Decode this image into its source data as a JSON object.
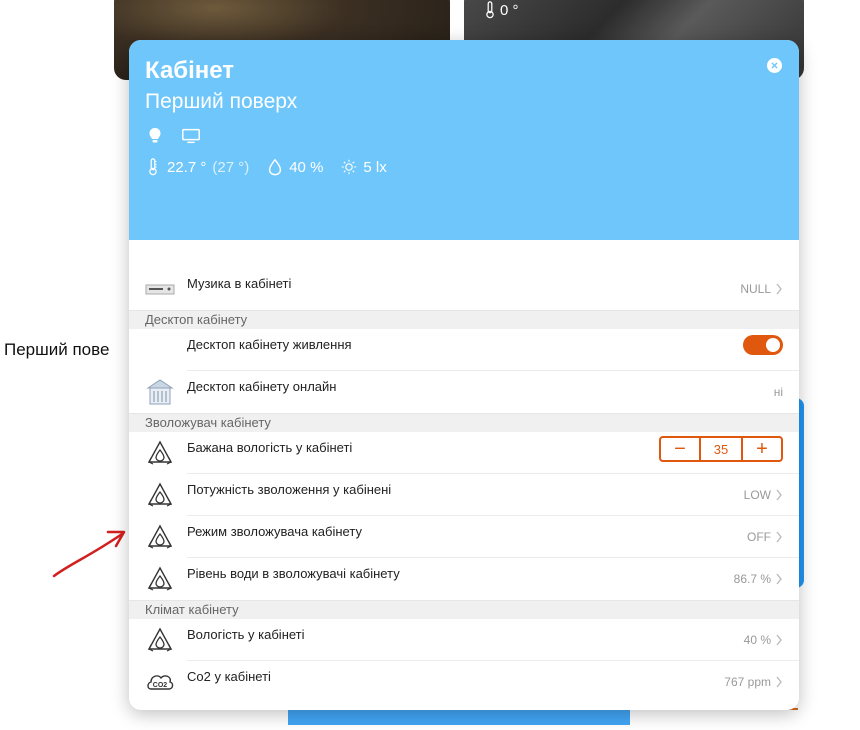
{
  "background": {
    "temp_card_value": "0 °",
    "floor_label": "Перший пове"
  },
  "modal": {
    "title": "Кабінет",
    "subtitle": "Перший поверх",
    "devices": [
      "bulb-icon",
      "monitor-icon"
    ],
    "sensors": {
      "temperature": "22.7 °",
      "temperature_feel": "(27 °)",
      "humidity": "40 %",
      "illuminance": "5 lx"
    },
    "colors": {
      "header": "#6ec6fa",
      "accent": "#e0580e"
    }
  },
  "rows": {
    "music": {
      "label": "Музика в кабінеті",
      "value": "NULL",
      "icon": "media-player-icon"
    },
    "group_desktop": "Десктоп кабінету",
    "desktop_power": {
      "label": "Десктоп кабінету живлення",
      "state": "on"
    },
    "desktop_online": {
      "label": "Десктоп кабінету онлайн",
      "value": "ні",
      "icon": "building-icon"
    },
    "group_humidifier": "Зволожувач кабінету",
    "target_humidity": {
      "label": "Бажана вологість у кабінеті",
      "value": "35",
      "minus": "−",
      "plus": "+"
    },
    "humidify_power": {
      "label": "Потужність зволоження у кабінені",
      "value": "LOW"
    },
    "humidifier_mode": {
      "label": "Режим зволожувача кабінету",
      "value": "OFF"
    },
    "water_level": {
      "label": "Рівень води в зволожувачі кабінету",
      "value": "86.7 %"
    },
    "group_climate": "Клімат кабінету",
    "humidity": {
      "label": "Вологість у кабінеті",
      "value": "40 %"
    },
    "co2": {
      "label": "Co2 у кабінеті",
      "value": "767 ppm",
      "icon": "co2-icon"
    }
  }
}
